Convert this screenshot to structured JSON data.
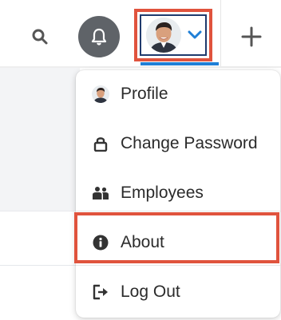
{
  "topbar": {
    "icons": {
      "search": "search-icon",
      "notifications": "bell-icon",
      "profile": "avatar",
      "chevron": "chevron-down-icon",
      "create": "plus-icon"
    }
  },
  "menu": {
    "items": [
      {
        "label": "Profile",
        "icon": "avatar"
      },
      {
        "label": "Change Password",
        "icon": "lock-icon"
      },
      {
        "label": "Employees",
        "icon": "people-icon"
      },
      {
        "label": "About",
        "icon": "info-icon"
      },
      {
        "label": "Log Out",
        "icon": "logout-icon"
      }
    ]
  },
  "colors": {
    "highlight": "#e0533d",
    "accent": "#1f7fd6",
    "notif_bg": "#5f6368"
  }
}
